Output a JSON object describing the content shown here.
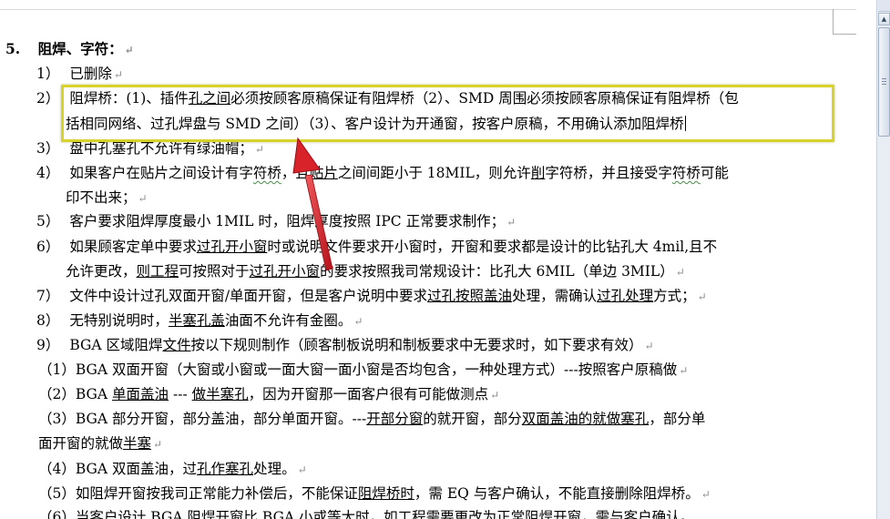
{
  "section": {
    "number": "5.",
    "title": "阻焊、字符："
  },
  "lines": {
    "l1": {
      "num": "1）",
      "t1": "已删除"
    },
    "l2": {
      "num": "2）",
      "t1": "阻焊桥：(1)、插件",
      "t2": "孔之间",
      "t3": "必须按顾客原稿保证有阻焊桥（2）、SMD 周围必须按顾客原稿保证有阻焊桥（包"
    },
    "l2b": {
      "t1": "括相同网络、过孔焊盘与 SMD 之间）（3）、客户设计为开通窗，按客户原稿，不用确认添加阻焊",
      "t2": "桥"
    },
    "l3": {
      "num": "3）",
      "t1": "盘中孔塞孔不允许有绿油帽；"
    },
    "l4": {
      "num": "4）",
      "t1": "如果客户在贴片之间设计有字",
      "t2": "符桥",
      "t3": "，且",
      "t4": "贴片",
      "t5": "之间间距小于 18MIL，则允许",
      "t6": "削",
      "t7": "字符桥，并且接受字",
      "t8": "符桥",
      "t9": "可能"
    },
    "l4b": {
      "t1": "印不出来；"
    },
    "l5": {
      "num": "5）",
      "t1": "客户要求阻焊厚度最小 1MIL 时，阻焊厚度按照 IPC 正常要求制作；"
    },
    "l6": {
      "num": "6）",
      "t1": "如果顾客定单中要求",
      "t2": "过孔开小窗",
      "t3": "时或说明文件要求开小窗时，开窗和要求都是设计的比钻孔大 4mil,且不"
    },
    "l6b": {
      "t1": "允许更改，",
      "t2": "则工程",
      "t3": "可按照对于",
      "t4": "过孔开小窗",
      "t5": "的要求按照我司常规设计：比孔大 6MIL（单边 3MIL）"
    },
    "l7": {
      "num": "7）",
      "t1": "文件中设计过孔双面开窗/单面开窗，但是客户说明中要求",
      "t2": "过孔按照盖油",
      "t3": "处理，需确认",
      "t4": "过孔处理",
      "t5": "方式；"
    },
    "l8": {
      "num": "8）",
      "t1": "无特别说明时，",
      "t2": "半塞孔盖",
      "t3": "油面不允许有金圈。"
    },
    "l9": {
      "num": "9）",
      "t1": "BGA 区域阻焊",
      "t2": "文件",
      "t3": "按以下规则制作（顾客制板说明和制板要求中无要求时，如下要求有效）"
    },
    "s1": {
      "t1": "（1）BGA 双面开窗（大窗或小窗或一面大窗一面小窗是否均包含，一种处理方式）---按照客户原稿做"
    },
    "s2": {
      "t1": "（2）BGA ",
      "t2": "单面盖油",
      "t3": " --- ",
      "t4": "做半塞孔",
      "t5": "，因为开窗那一面客户很有可能做测点"
    },
    "s3": {
      "t1": "（3）BGA 部分开窗，部分盖油，部分单面开窗。---",
      "t2": "开部分窗",
      "t3": "的就开窗，部分",
      "t4": "双面盖油的就做塞孔",
      "t5": "，部分单"
    },
    "s3b": {
      "t1": "面开窗的就做",
      "t2": "半塞"
    },
    "s4": {
      "t1": "（4）BGA 双面盖油，过",
      "t2": "孔作塞孔",
      "t3": "处理。"
    },
    "s5": {
      "t1": "（5）如阻焊开窗按我司正常能力补偿后，不能保证",
      "t2": "阻焊桥时",
      "t3": "，需 EQ 与客户确认，不能直接删除阻焊桥。"
    },
    "s6": {
      "t1": "（6）当客户设计 BGA 阻焊开窗比 BGA 小或等大时，如工程需要更改为正常阻焊开窗，需与客户确认。"
    }
  },
  "marks": {
    "paragraph": "↵"
  },
  "colors": {
    "highlight": "#d9d22a",
    "arrow": "#d8232a"
  },
  "icons": {
    "scroll_up": "scroll-up-arrow-icon",
    "ruler": "ruler-toggle-icon"
  }
}
